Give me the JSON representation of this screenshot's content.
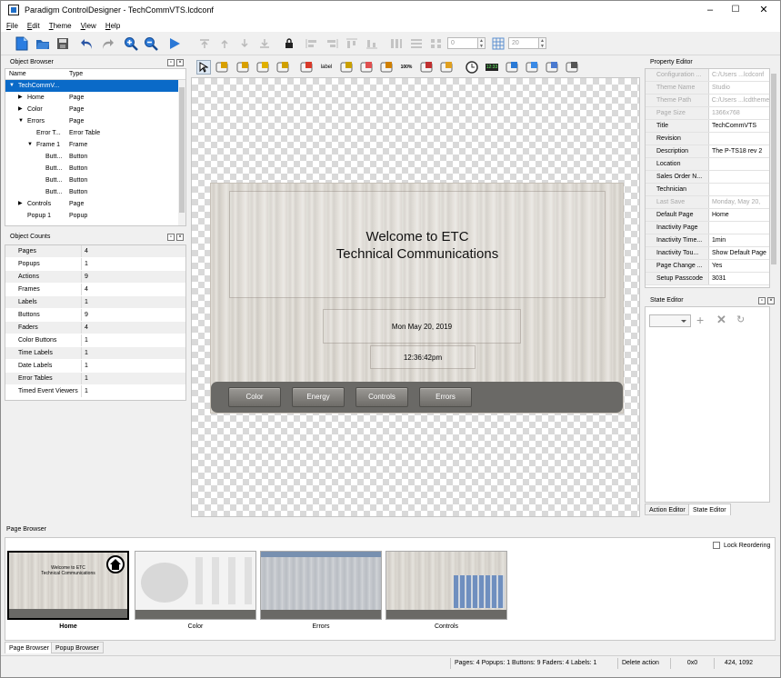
{
  "window": {
    "title": "Paradigm ControlDesigner - TechCommVTS.lcdconf"
  },
  "menu": [
    "File",
    "Edit",
    "Theme",
    "View",
    "Help"
  ],
  "toolbar": {
    "spin1_value": "0",
    "spin2_value": "20"
  },
  "icons": {
    "new": "new-file-icon",
    "open": "open-folder-icon",
    "save": "save-disk-icon",
    "undo": "undo-arrow-icon",
    "redo": "redo-arrow-icon",
    "zoom_in": "zoom-in-icon",
    "zoom_out": "zoom-out-icon",
    "play": "play-icon",
    "lock": "lock-icon",
    "grid": "grid-icon"
  },
  "object_browser": {
    "title": "Object Browser",
    "columns": [
      "Name",
      "Type"
    ],
    "rows": [
      {
        "name": "TechCommV...",
        "type": "",
        "level": 0,
        "expanded": true,
        "selected": true
      },
      {
        "name": "Home",
        "type": "Page",
        "level": 1,
        "expanded": false
      },
      {
        "name": "Color",
        "type": "Page",
        "level": 1,
        "expanded": false
      },
      {
        "name": "Errors",
        "type": "Page",
        "level": 1,
        "expanded": true
      },
      {
        "name": "Error T...",
        "type": "Error Table",
        "level": 2
      },
      {
        "name": "Frame 1",
        "type": "Frame",
        "level": 2,
        "expanded": true
      },
      {
        "name": "Butt...",
        "type": "Button",
        "level": 3
      },
      {
        "name": "Butt...",
        "type": "Button",
        "level": 3
      },
      {
        "name": "Butt...",
        "type": "Button",
        "level": 3
      },
      {
        "name": "Butt...",
        "type": "Button",
        "level": 3
      },
      {
        "name": "Controls",
        "type": "Page",
        "level": 1,
        "expanded": false
      },
      {
        "name": "Popup 1",
        "type": "Popup",
        "level": 1
      }
    ]
  },
  "object_counts": {
    "title": "Object Counts",
    "rows": [
      {
        "k": "Pages",
        "v": "4"
      },
      {
        "k": "Popups",
        "v": "1"
      },
      {
        "k": "Actions",
        "v": "9"
      },
      {
        "k": "Frames",
        "v": "4"
      },
      {
        "k": "Labels",
        "v": "1"
      },
      {
        "k": "Buttons",
        "v": "9"
      },
      {
        "k": "Faders",
        "v": "4"
      },
      {
        "k": "Color Buttons",
        "v": "1"
      },
      {
        "k": "Time Labels",
        "v": "1"
      },
      {
        "k": "Date Labels",
        "v": "1"
      },
      {
        "k": "Error Tables",
        "v": "1"
      },
      {
        "k": "Timed Event Viewers",
        "v": "1"
      }
    ]
  },
  "page_tools": {
    "label_text": "label",
    "percent_text": "100%",
    "count_text": "12:33"
  },
  "canvas": {
    "welcome_line1": "Welcome to ETC",
    "welcome_line2": "Technical Communications",
    "date": "Mon May 20, 2019",
    "time": "12:36:42pm",
    "nav_buttons": [
      "Color",
      "Energy",
      "Controls",
      "Errors"
    ]
  },
  "property_editor": {
    "title": "Property Editor",
    "rows": [
      {
        "k": "Configuration ...",
        "v": "C:/Users ...lcdconf",
        "disabled": true
      },
      {
        "k": "Theme Name",
        "v": "Studio",
        "disabled": true
      },
      {
        "k": "Theme Path",
        "v": "C:/Users ...lcdtheme",
        "disabled": true
      },
      {
        "k": "Page Size",
        "v": "1366x768",
        "disabled": true
      },
      {
        "k": "Title",
        "v": "TechCommVTS",
        "disabled": false
      },
      {
        "k": "Revision",
        "v": "",
        "disabled": false
      },
      {
        "k": "Description",
        "v": "The P-TS18 rev 2",
        "disabled": false
      },
      {
        "k": "Location",
        "v": "",
        "disabled": false
      },
      {
        "k": "Sales Order N...",
        "v": "",
        "disabled": false
      },
      {
        "k": "Technician",
        "v": "",
        "disabled": false
      },
      {
        "k": "Last Save",
        "v": "Monday, May 20,",
        "disabled": true
      },
      {
        "k": "Default Page",
        "v": "Home",
        "disabled": false
      },
      {
        "k": "Inactivity Page",
        "v": "",
        "disabled": false
      },
      {
        "k": "Inactivity Time...",
        "v": "1min",
        "disabled": false
      },
      {
        "k": "Inactivity Tou...",
        "v": "Show Default Page",
        "disabled": false
      },
      {
        "k": "Page Change ...",
        "v": "Yes",
        "disabled": false
      },
      {
        "k": "Setup Passcode",
        "v": "3031",
        "disabled": false
      }
    ]
  },
  "state_editor": {
    "title": "State Editor",
    "tabs": [
      "Action Editor",
      "State Editor"
    ]
  },
  "page_browser": {
    "title": "Page Browser",
    "lock_label": "Lock Reordering",
    "thumbs": [
      "Home",
      "Color",
      "Errors",
      "Controls"
    ],
    "thumb_home_text1": "Welcome to ETC",
    "thumb_home_text2": "Technical Communications",
    "tabs": [
      "Page Browser",
      "Popup Browser"
    ]
  },
  "status": {
    "counts": "Pages: 4  Popups: 1  Buttons: 9  Faders: 4  Labels: 1",
    "action": "Delete action",
    "pos": "0x0",
    "coords": "424, 1092"
  }
}
